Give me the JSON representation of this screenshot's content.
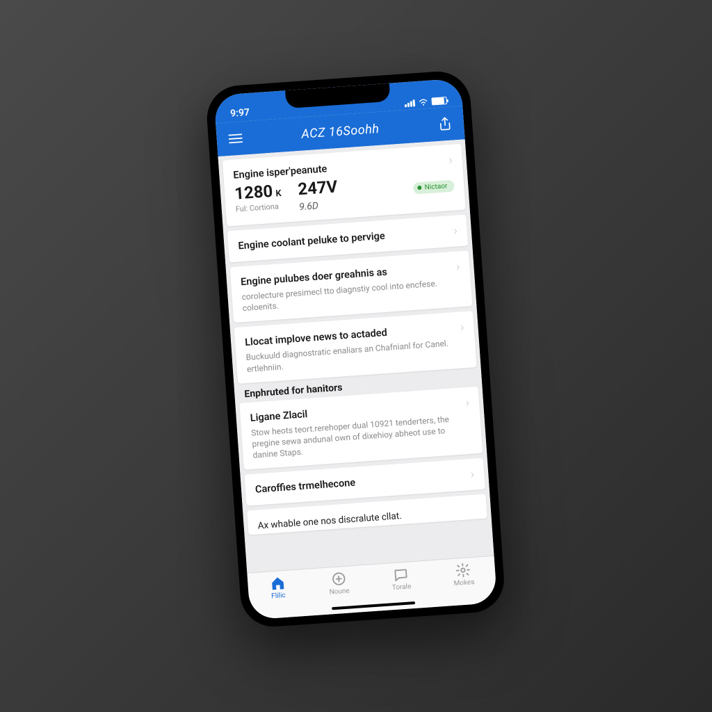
{
  "status": {
    "time": "9:97"
  },
  "header": {
    "title": "ACZ 16Soohh"
  },
  "top_row": {
    "title": "Engine isper'peanute"
  },
  "stats": {
    "v1": "1280",
    "u1": "K",
    "l1": "Ful: Cortiona",
    "v2": "247V",
    "script": "9.6D",
    "badge": "Nictaor"
  },
  "rows": [
    {
      "title": "Engine coolant peluke to pervige"
    },
    {
      "title": "Engine pulubes doer greahnis as",
      "sub": "corolecture presimecl tto diagnstiy cool into encfese. coloenits."
    },
    {
      "title": "Llocat implove news to actaded",
      "sub": "Buckuuld diagnostratic enaliars an Chafnianl for Canel. ertlehniin."
    }
  ],
  "section": "Enphruted for hanitors",
  "story": {
    "title": "Ligane Zlacil",
    "body": "Stow heots teort.rerehoper dual 10921 tenderters, the pregine sewa andunal own of dixehioy abheot use to danine Staps."
  },
  "bottom_rows": [
    {
      "title": "Caroffies trmelhecone"
    },
    {
      "title": "Ax whable one nos discralute cllat."
    }
  ],
  "tabs": [
    {
      "label": "Flilic",
      "icon": "home",
      "active": true
    },
    {
      "label": "Noune",
      "icon": "plus-circle",
      "active": false
    },
    {
      "label": "Torale",
      "icon": "chat",
      "active": false
    },
    {
      "label": "Mokes",
      "icon": "gear",
      "active": false
    }
  ]
}
